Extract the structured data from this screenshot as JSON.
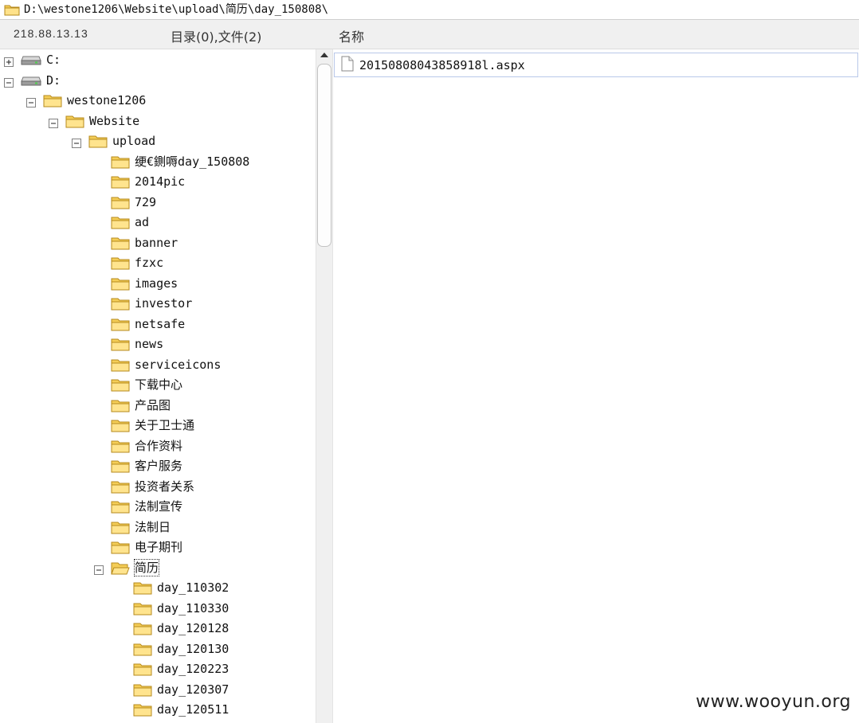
{
  "path_bar": {
    "path": "D:\\westone1206\\Website\\upload\\简历\\day_150808\\"
  },
  "header": {
    "ip": "218.88.13.13",
    "count": "目录(0),文件(2)",
    "column_name": "名称"
  },
  "tree": [
    {
      "label": "C:",
      "type": "drive",
      "expander": "plus",
      "cjk": false,
      "selected": false
    },
    {
      "label": "D:",
      "type": "drive",
      "expander": "minus",
      "cjk": false,
      "selected": false
    },
    {
      "label": "westone1206",
      "type": "folder",
      "expander": "minus",
      "cjk": false,
      "selected": false
    },
    {
      "label": "Website",
      "type": "folder",
      "expander": "minus",
      "cjk": false,
      "selected": false
    },
    {
      "label": "upload",
      "type": "folder",
      "expander": "minus",
      "cjk": false,
      "selected": false
    },
    {
      "label": "绠€鍘嗕day_150808",
      "type": "folder",
      "expander": "none",
      "cjk": false,
      "selected": false
    },
    {
      "label": "2014pic",
      "type": "folder",
      "expander": "none",
      "cjk": false,
      "selected": false
    },
    {
      "label": "729",
      "type": "folder",
      "expander": "none",
      "cjk": false,
      "selected": false
    },
    {
      "label": "ad",
      "type": "folder",
      "expander": "none",
      "cjk": false,
      "selected": false
    },
    {
      "label": "banner",
      "type": "folder",
      "expander": "none",
      "cjk": false,
      "selected": false
    },
    {
      "label": "fzxc",
      "type": "folder",
      "expander": "none",
      "cjk": false,
      "selected": false
    },
    {
      "label": "images",
      "type": "folder",
      "expander": "none",
      "cjk": false,
      "selected": false
    },
    {
      "label": "investor",
      "type": "folder",
      "expander": "none",
      "cjk": false,
      "selected": false
    },
    {
      "label": "netsafe",
      "type": "folder",
      "expander": "none",
      "cjk": false,
      "selected": false
    },
    {
      "label": "news",
      "type": "folder",
      "expander": "none",
      "cjk": false,
      "selected": false
    },
    {
      "label": "serviceicons",
      "type": "folder",
      "expander": "none",
      "cjk": false,
      "selected": false
    },
    {
      "label": "下载中心",
      "type": "folder",
      "expander": "none",
      "cjk": true,
      "selected": false
    },
    {
      "label": "产品图",
      "type": "folder",
      "expander": "none",
      "cjk": true,
      "selected": false
    },
    {
      "label": "关于卫士通",
      "type": "folder",
      "expander": "none",
      "cjk": true,
      "selected": false
    },
    {
      "label": "合作资料",
      "type": "folder",
      "expander": "none",
      "cjk": true,
      "selected": false
    },
    {
      "label": "客户服务",
      "type": "folder",
      "expander": "none",
      "cjk": true,
      "selected": false
    },
    {
      "label": "投资者关系",
      "type": "folder",
      "expander": "none",
      "cjk": true,
      "selected": false
    },
    {
      "label": "法制宣传",
      "type": "folder",
      "expander": "none",
      "cjk": true,
      "selected": false
    },
    {
      "label": "法制日",
      "type": "folder",
      "expander": "none",
      "cjk": true,
      "selected": false
    },
    {
      "label": "电子期刊",
      "type": "folder",
      "expander": "none",
      "cjk": true,
      "selected": false
    },
    {
      "label": "简历",
      "type": "folder-open",
      "expander": "minus",
      "cjk": true,
      "selected": true
    },
    {
      "label": "day_110302",
      "type": "folder",
      "expander": "none",
      "cjk": false,
      "selected": false
    },
    {
      "label": "day_110330",
      "type": "folder",
      "expander": "none",
      "cjk": false,
      "selected": false
    },
    {
      "label": "day_120128",
      "type": "folder",
      "expander": "none",
      "cjk": false,
      "selected": false
    },
    {
      "label": "day_120130",
      "type": "folder",
      "expander": "none",
      "cjk": false,
      "selected": false
    },
    {
      "label": "day_120223",
      "type": "folder",
      "expander": "none",
      "cjk": false,
      "selected": false
    },
    {
      "label": "day_120307",
      "type": "folder",
      "expander": "none",
      "cjk": false,
      "selected": false
    },
    {
      "label": "day_120511",
      "type": "folder",
      "expander": "none",
      "cjk": false,
      "selected": false
    },
    {
      "label": "",
      "type": "folder",
      "expander": "none",
      "cjk": false,
      "selected": false
    }
  ],
  "files": [
    {
      "name": "20150808043858918l.aspx"
    }
  ],
  "watermark": "www.wooyun.org"
}
